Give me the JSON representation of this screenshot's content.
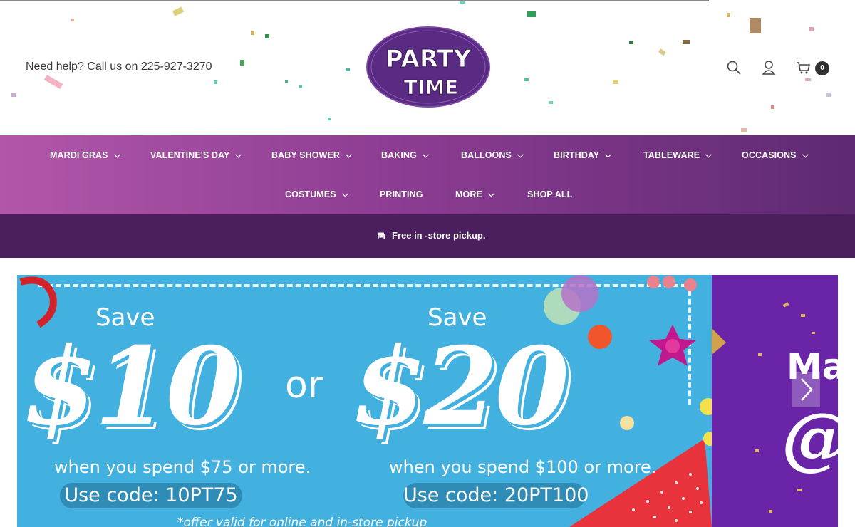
{
  "header": {
    "help_text": "Need help? Call us on 225-927-3270",
    "logo_line1": "PARTY",
    "logo_line2": "TIME",
    "icons": [
      "search-icon",
      "account-icon",
      "cart-icon"
    ],
    "cart_count": "0"
  },
  "nav": {
    "items": [
      {
        "label": "MARDI GRAS",
        "has_dropdown": true
      },
      {
        "label": "VALENTINE'S DAY",
        "has_dropdown": true
      },
      {
        "label": "BABY SHOWER",
        "has_dropdown": true
      },
      {
        "label": "BAKING",
        "has_dropdown": true
      },
      {
        "label": "BALLOONS",
        "has_dropdown": true
      },
      {
        "label": "BIRTHDAY",
        "has_dropdown": true
      },
      {
        "label": "TABLEWARE",
        "has_dropdown": true
      },
      {
        "label": "OCCASIONS",
        "has_dropdown": true
      },
      {
        "label": "COSTUMES",
        "has_dropdown": true
      },
      {
        "label": "PRINTING",
        "has_dropdown": false
      },
      {
        "label": "MORE",
        "has_dropdown": true
      },
      {
        "label": "SHOP ALL",
        "has_dropdown": false
      }
    ]
  },
  "promo": {
    "icon": "car-icon",
    "text": "Free in -store pickup."
  },
  "hero": {
    "slide1": {
      "offer1": {
        "save": "Save",
        "amount": "$10",
        "spend": "when you spend $75 or more.",
        "code": "Use code: 10PT75"
      },
      "or": "or",
      "offer2": {
        "save": "Save",
        "amount": "$20",
        "spend": "when you spend $100 or more.",
        "code": "Use code: 20PT100"
      },
      "fine_print": "*offer valid for online and in-store pickup"
    },
    "slide2": {
      "title": "Mal",
      "script": "@"
    }
  },
  "colors": {
    "nav_gradient_start": "#b157a9",
    "nav_gradient_end": "#5e2a72",
    "promo_bar": "#4b1f5e",
    "hero_blue": "#43b1e0",
    "slide2_purple": "#6a24a7",
    "logo_purple": "#5a2b82"
  }
}
